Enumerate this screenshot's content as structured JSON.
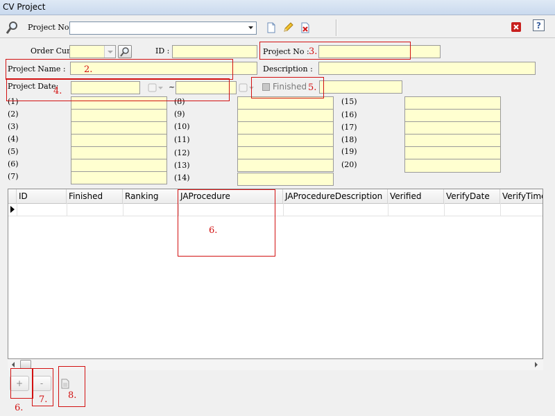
{
  "window": {
    "title": "CV Project"
  },
  "toolbar": {
    "project_no_label": "Project No :",
    "project_no_value": "",
    "search_icon": "magnifier-icon",
    "new_icon": "new-document-icon",
    "edit_icon": "pencil-icon",
    "delete_icon": "delete-icon",
    "close_icon": "red-close-icon",
    "help_label": "?"
  },
  "form": {
    "order_curr_label": "Order Curr:",
    "id_label": "ID :",
    "project_no_label": "Project No :",
    "project_name_label": "Project Name :",
    "description_label": "Description :",
    "project_date_label": "Project Date:",
    "date_separator": "~",
    "finished_label": "Finished"
  },
  "fields": {
    "col1": [
      "(1)",
      "(2)",
      "(3)",
      "(4)",
      "(5)",
      "(6)",
      "(7)"
    ],
    "col2": [
      "(8)",
      "(9)",
      "(10)",
      "(11)",
      "(12)",
      "(13)",
      "(14)"
    ],
    "col3": [
      "(15)",
      "(16)",
      "(17)",
      "(18)",
      "(19)",
      "(20)"
    ]
  },
  "grid": {
    "columns": [
      "ID",
      "Finished",
      "Ranking",
      "JAProcedure",
      "JAProcedureDescription",
      "Verified",
      "VerifyDate",
      "VerifyTime"
    ],
    "rows": []
  },
  "bottom_buttons": {
    "add_label": "+",
    "remove_label": "-",
    "doc_icon": "document-icon"
  },
  "annotations": [
    "2.",
    "3.",
    "4.",
    "5.",
    "6.",
    "6.",
    "7.",
    "8."
  ],
  "colors": {
    "field_bg": "#ffffd0",
    "annotation": "#d21010"
  }
}
